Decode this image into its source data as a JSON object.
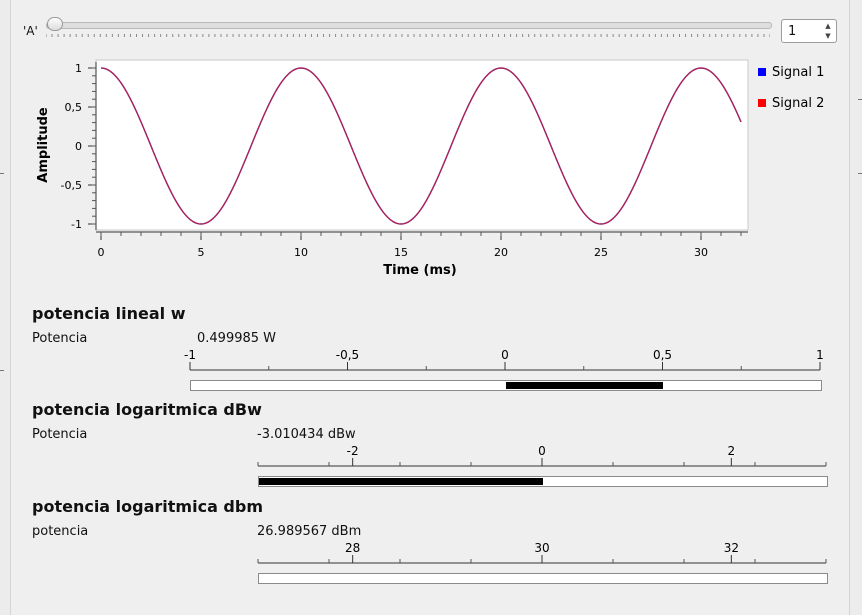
{
  "slider": {
    "label": "'A'",
    "value": 1,
    "min": 1,
    "max": 100,
    "fill_color": "#3a8ee6"
  },
  "spinbox": {
    "value": "1",
    "up_icon": "caret-up",
    "down_icon": "caret-down"
  },
  "chart_data": {
    "type": "line",
    "xlabel": "Time (ms)",
    "ylabel": "Amplitude",
    "xlim": [
      0,
      32
    ],
    "ylim": [
      -1,
      1
    ],
    "x_ticks": [
      "0",
      "5",
      "10",
      "15",
      "20",
      "25",
      "30"
    ],
    "y_ticks": [
      "1",
      "0,5",
      "0",
      "-0,5",
      "-1"
    ],
    "legend_position": "right",
    "series": [
      {
        "name": "Signal 1",
        "color": "#0000ff",
        "function": "cos",
        "amplitude": 1,
        "period_ms": 10,
        "x": [
          0,
          2.5,
          5,
          7.5,
          10,
          12.5,
          15,
          17.5,
          20,
          22.5,
          25,
          27.5,
          30,
          32
        ],
        "y": [
          1,
          0,
          -1,
          0,
          1,
          0,
          -1,
          0,
          1,
          0,
          -1,
          0,
          1,
          0.31
        ]
      },
      {
        "name": "Signal 2",
        "color": "#ff0000",
        "function": "cos",
        "amplitude": 1,
        "period_ms": 10,
        "x": [
          0,
          2.5,
          5,
          7.5,
          10,
          12.5,
          15,
          17.5,
          20,
          22.5,
          25,
          27.5,
          30,
          32
        ],
        "y": [
          1,
          0,
          -1,
          0,
          1,
          0,
          -1,
          0,
          1,
          0,
          -1,
          0,
          1,
          0.31
        ]
      }
    ],
    "visible_line_color": "#b3234d"
  },
  "sections": [
    {
      "title": "potencia lineal w",
      "label": "Potencia",
      "value": "0.499985 W",
      "scale_labels": [
        "-1",
        "-0,5",
        "0",
        "0,5",
        "1"
      ],
      "scale_min": -1,
      "scale_max": 1,
      "bar_from": 0,
      "bar_to": 0.499985
    },
    {
      "title": "potencia logaritmica dBw",
      "label": "Potencia",
      "value": "-3.010434 dBw",
      "scale_labels": [
        "-2",
        "0",
        "2"
      ],
      "scale_min": -3,
      "scale_max": 3,
      "bar_from": -3,
      "bar_to": 0
    },
    {
      "title": "potencia logaritmica dbm",
      "label": "potencia",
      "value": "26.989567 dBm",
      "scale_labels": [
        "28",
        "30",
        "32"
      ],
      "scale_min": 27,
      "scale_max": 33,
      "bar_from": 27,
      "bar_to": 27
    }
  ]
}
